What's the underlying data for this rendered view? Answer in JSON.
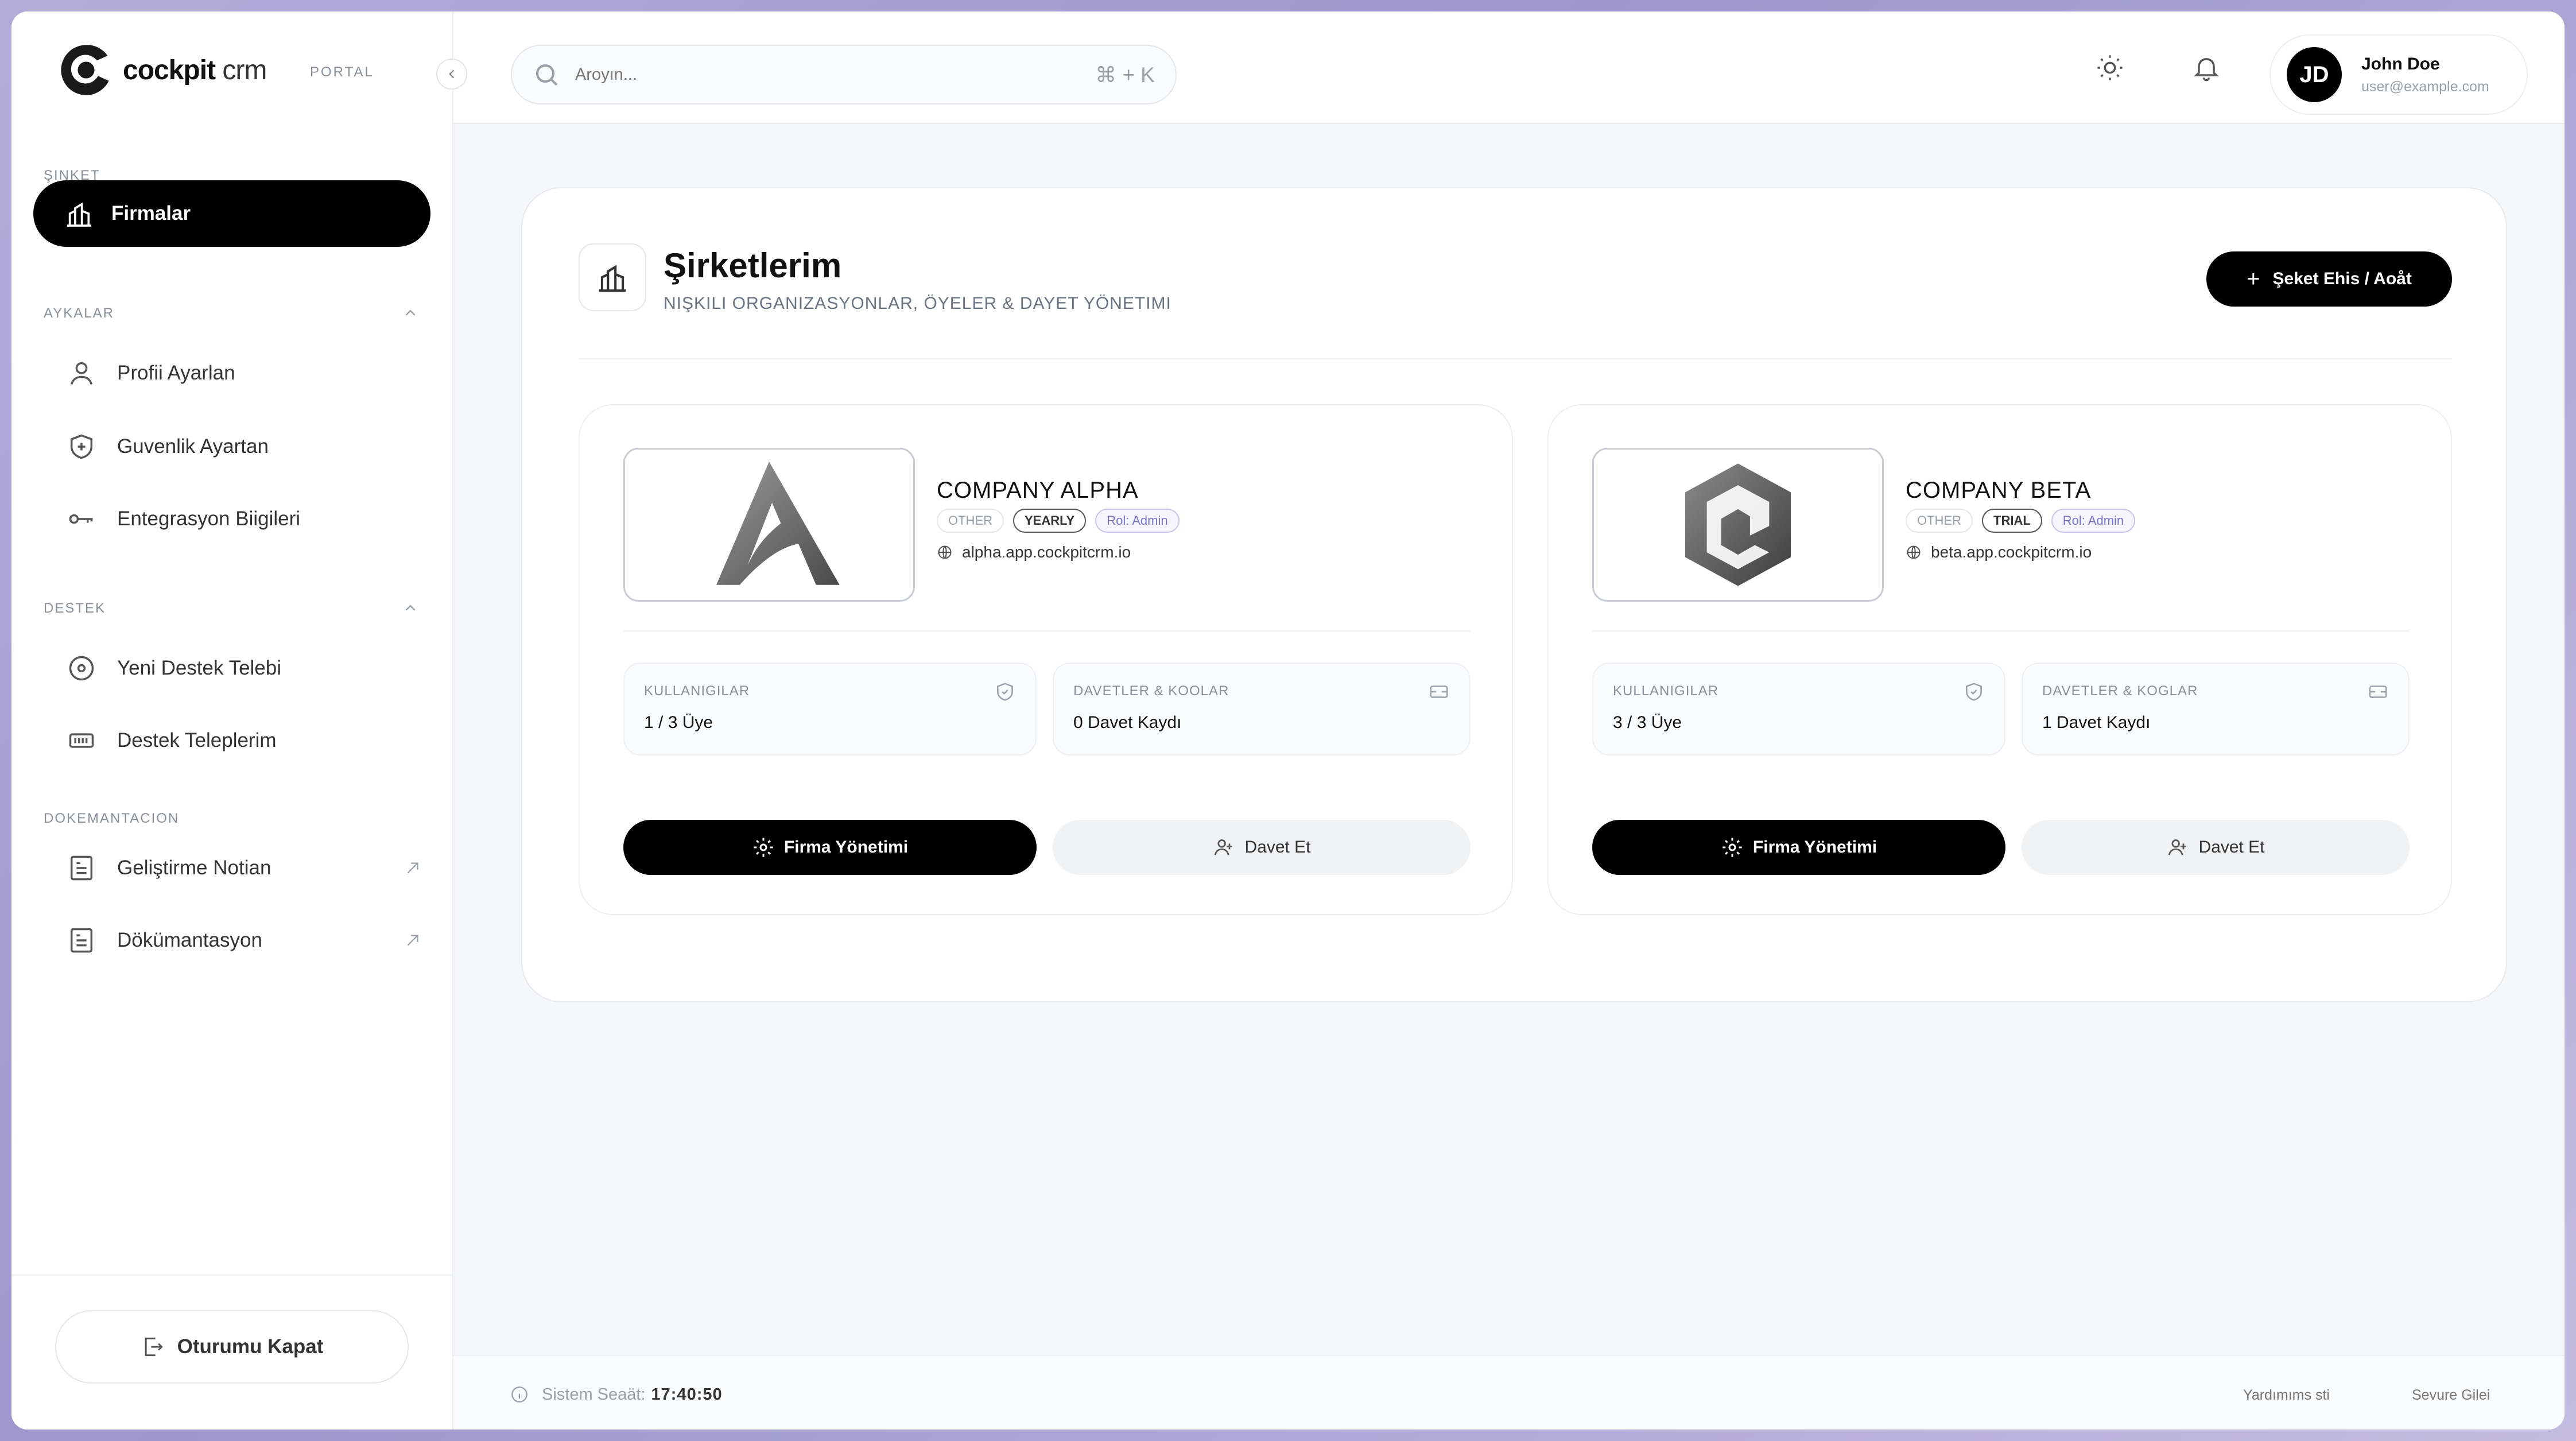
{
  "brand": {
    "name_bold": "cockpit",
    "name_light": " crm",
    "portal": "PORTAL"
  },
  "sidebar": {
    "section_company": "ŞINKET",
    "active_item": "Firmalar",
    "section_settings": "AYKALAR",
    "settings_items": [
      "Profii Ayarlan",
      "Guvenlik Ayartan",
      "Entegrasyon Biigileri"
    ],
    "section_support": "DESTEK",
    "support_items": [
      "Yeni Destek Telebi",
      "Destek Teleplerim"
    ],
    "section_docs": "DOKEMANTACION",
    "docs_items": [
      "Geliştirme Notian",
      "Dökümantasyon"
    ],
    "logout": "Oturumu Kapat"
  },
  "header": {
    "search_placeholder": "Aroyın...",
    "search_shortcut": "⌘ + K",
    "user_initials": "JD",
    "user_name": "John Doe",
    "user_email": "user@example.com"
  },
  "main": {
    "title": "Şirketlerim",
    "subtitle": "NIŞKILI ORGANIZASYONLAR, ÖYELER & DAYET YÖNETIMI",
    "add_button": "Şeket Ehis / Aoåt"
  },
  "companies": [
    {
      "name": "COMPANY ALPHA",
      "badges": [
        "OTHER",
        "YEARLY",
        "Rol: Admin"
      ],
      "domain": "alpha.app.cockpitcrm.io",
      "users_label": "KULLANIGILAR",
      "users_value": "1 / 3 Üye",
      "invites_label": "DAVETLER & KOOLAR",
      "invites_value": "0 Davet Kaydı",
      "manage_button": "Firma Yönetimi",
      "invite_button": "Davet Et"
    },
    {
      "name": "COMPANY BETA",
      "badges": [
        "OTHER",
        "TRIAL",
        "Rol: Admin"
      ],
      "domain": "beta.app.cockpitcrm.io",
      "users_label": "KULLANIGILAR",
      "users_value": "3 / 3 Üye",
      "invites_label": "DAVETLER & KOGLAR",
      "invites_value": "1 Davet Kaydı",
      "manage_button": "Firma Yönetimi",
      "invite_button": "Davet Et"
    }
  ],
  "footer": {
    "clock_label": "Sistem Seaät:",
    "clock_time": "17:40:50",
    "link_help": "Yardımıms sti",
    "link_secure": "Sevure Gilei"
  },
  "colors": {
    "accent": "#000000",
    "role_badge": "#7a73c4",
    "background": "#f6f7f9"
  }
}
